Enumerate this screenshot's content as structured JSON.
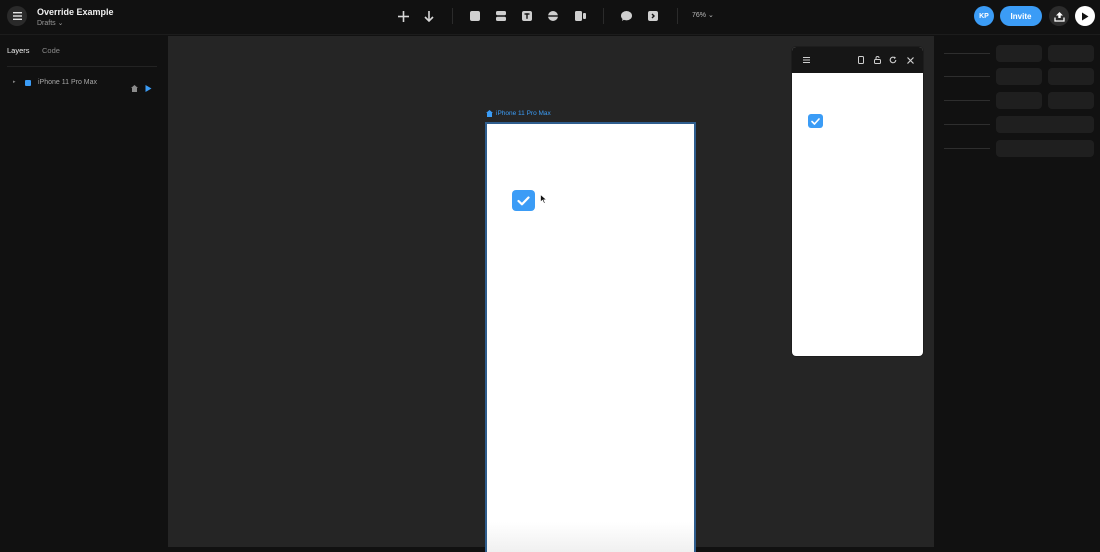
{
  "app": {
    "title": "Override Example",
    "subtitle": "Drafts",
    "zoom": "76%",
    "user_initials": "KP",
    "invite_label": "Invite"
  },
  "toolbar": {
    "icons": [
      "plus-icon",
      "arrow-down-icon",
      "frame-icon",
      "stack-icon",
      "text-icon",
      "component-icon",
      "video-icon",
      "comment-icon",
      "code-icon"
    ],
    "menu_icon": "hamburger-icon",
    "publish_icon": "upload-icon",
    "play_icon": "play-icon"
  },
  "left_panel": {
    "tabs": [
      {
        "label": "Layers",
        "active": true
      },
      {
        "label": "Code",
        "active": false
      }
    ],
    "layers": [
      {
        "label": "iPhone 11 Pro Max",
        "color": "#3b9cf6"
      }
    ]
  },
  "canvas": {
    "frame_label": "iPhone 11 Pro Max",
    "checkbox_checked": true
  },
  "preview": {
    "icons": [
      "hamburger-icon",
      "device-icon",
      "lock-icon",
      "refresh-icon",
      "close-icon"
    ],
    "checkbox_checked": true
  },
  "colors": {
    "accent": "#3b9cf6",
    "canvas": "#252525",
    "panel": "#111111"
  }
}
